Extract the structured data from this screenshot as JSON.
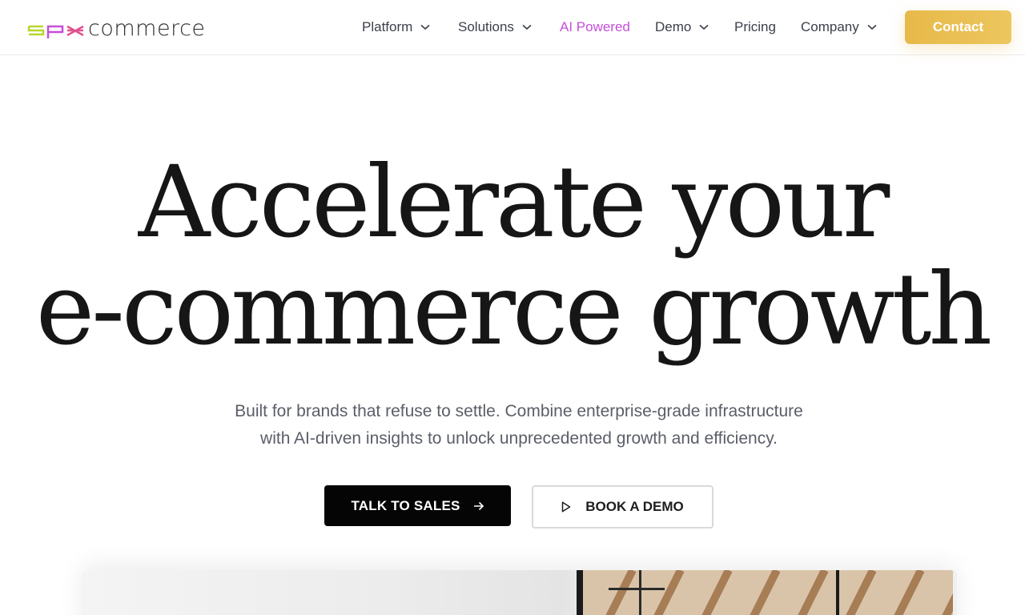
{
  "brand": {
    "logo_text": "commerce",
    "logo_mark_colors": [
      "#b6d62a",
      "#c54fd8",
      "#e0518f"
    ]
  },
  "nav": {
    "items": [
      {
        "label": "Platform",
        "has_dropdown": true
      },
      {
        "label": "Solutions",
        "has_dropdown": true
      },
      {
        "label": "AI Powered",
        "has_dropdown": false,
        "accent": true
      },
      {
        "label": "Demo",
        "has_dropdown": true
      },
      {
        "label": "Pricing",
        "has_dropdown": false
      },
      {
        "label": "Company",
        "has_dropdown": true
      }
    ],
    "contact_label": "Contact",
    "accent_color": "#c54fd8",
    "contact_color": "#e8b94a"
  },
  "hero": {
    "title_line1": "Accelerate your",
    "title_line2": "e-commerce growth",
    "subtitle_line1": "Built for brands that refuse to settle. Combine enterprise-grade infrastructure",
    "subtitle_line2": "with AI-driven insights to unlock unprecedented growth and efficiency.",
    "primary_cta": "TALK TO SALES",
    "secondary_cta": "BOOK A DEMO"
  }
}
